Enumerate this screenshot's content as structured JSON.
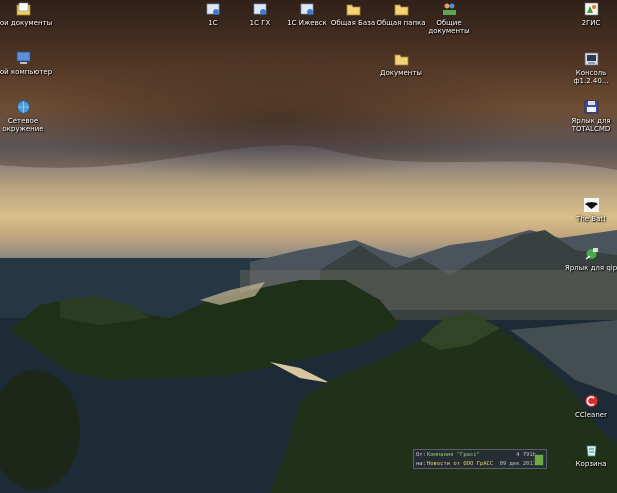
{
  "desktop": {
    "icons": [
      {
        "id": "my-documents",
        "label": "Мои документы",
        "icon": "folder-documents-icon"
      },
      {
        "id": "my-computer",
        "label": "Мой компьютер",
        "icon": "computer-icon"
      },
      {
        "id": "network",
        "label": "Сетевое окружение",
        "icon": "network-icon"
      },
      {
        "id": "1c",
        "label": "1С",
        "icon": "1c-icon"
      },
      {
        "id": "1c-gh",
        "label": "1С ГХ",
        "icon": "1c-icon"
      },
      {
        "id": "1c-izhevsk",
        "label": "1С Ижевск",
        "icon": "1c-icon"
      },
      {
        "id": "shared-base",
        "label": "Общая База",
        "icon": "folder-icon"
      },
      {
        "id": "shared-folder",
        "label": "Общая папка",
        "icon": "folder-icon"
      },
      {
        "id": "shared-docs",
        "label": "Общие документы",
        "icon": "users-folder-icon"
      },
      {
        "id": "documents",
        "label": "Документы",
        "icon": "folder-icon"
      },
      {
        "id": "2gis",
        "label": "2ГИС",
        "icon": "2gis-icon"
      },
      {
        "id": "console",
        "label": "Консоль ф1.2.40...",
        "icon": "console-icon"
      },
      {
        "id": "totalcmd",
        "label": "Ярлык для TOTALCMD",
        "icon": "floppy-icon"
      },
      {
        "id": "thebat",
        "label": "The Bat!",
        "icon": "bat-icon"
      },
      {
        "id": "qip",
        "label": "Ярлык для qip",
        "icon": "qip-icon"
      },
      {
        "id": "ccleaner",
        "label": "CCleaner",
        "icon": "ccleaner-icon"
      },
      {
        "id": "recycle",
        "label": "Корзина",
        "icon": "recycle-bin-icon"
      }
    ]
  },
  "notification": {
    "from_label": "От:",
    "from_value": "Компания \"Грасс\"",
    "size": "4 791b",
    "subject_label": "на:",
    "subject_value": "Новости от ООО ГрАСС",
    "date": "09 дек 2011",
    "icon": "mail-icon"
  }
}
